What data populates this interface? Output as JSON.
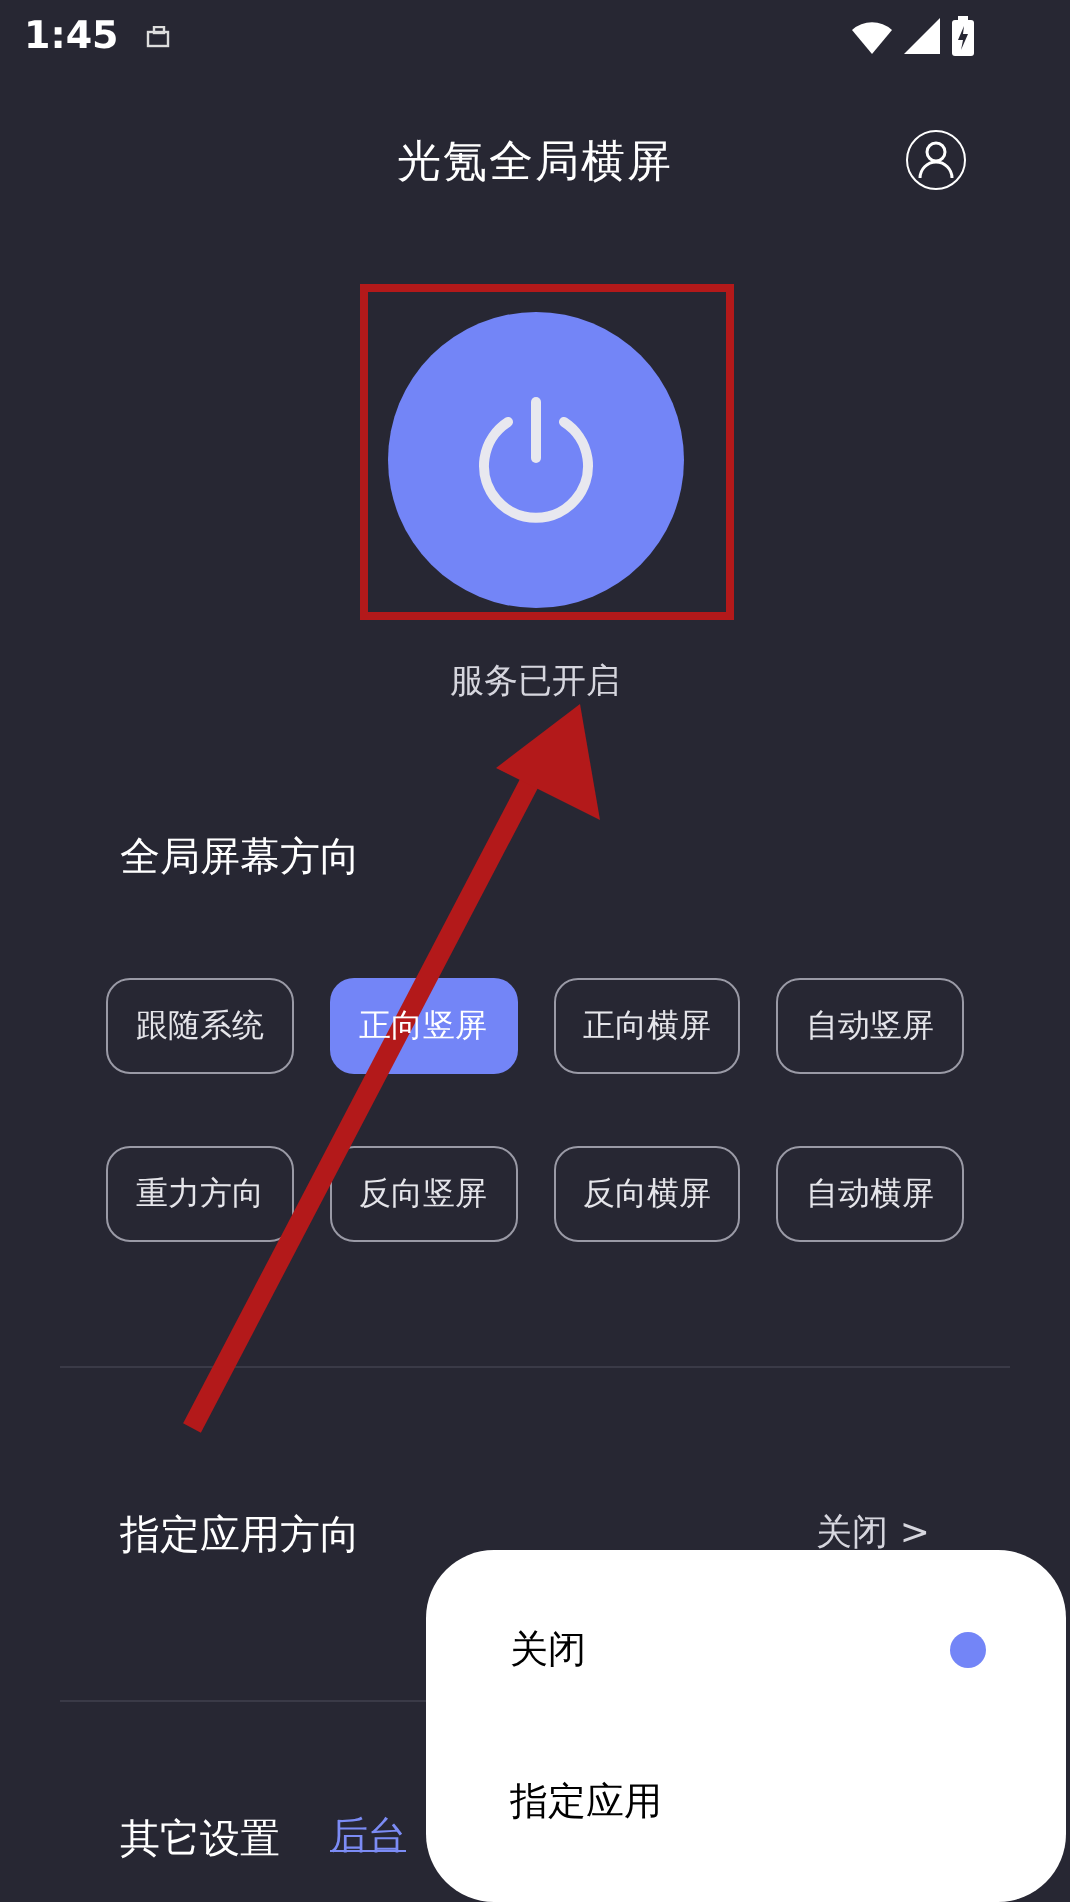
{
  "status_bar": {
    "time": "1:45"
  },
  "header": {
    "title": "光氪全局横屏"
  },
  "power": {
    "on": true,
    "status": "服务已开启"
  },
  "orientation": {
    "title": "全局屏幕方向",
    "options": [
      {
        "label": "跟随系统",
        "selected": false
      },
      {
        "label": "正向竖屏",
        "selected": true
      },
      {
        "label": "正向横屏",
        "selected": false
      },
      {
        "label": "自动竖屏",
        "selected": false
      },
      {
        "label": "重力方向",
        "selected": false
      },
      {
        "label": "反向竖屏",
        "selected": false
      },
      {
        "label": "反向横屏",
        "selected": false
      },
      {
        "label": "自动横屏",
        "selected": false
      }
    ]
  },
  "app_orientation": {
    "title": "指定应用方向",
    "value": "关闭",
    "chevron": ">"
  },
  "other": {
    "title": "其它设置",
    "link": "后台"
  },
  "popup_menu": {
    "items": [
      {
        "label": "关闭",
        "selected": true
      },
      {
        "label": "指定应用",
        "selected": false
      }
    ]
  }
}
